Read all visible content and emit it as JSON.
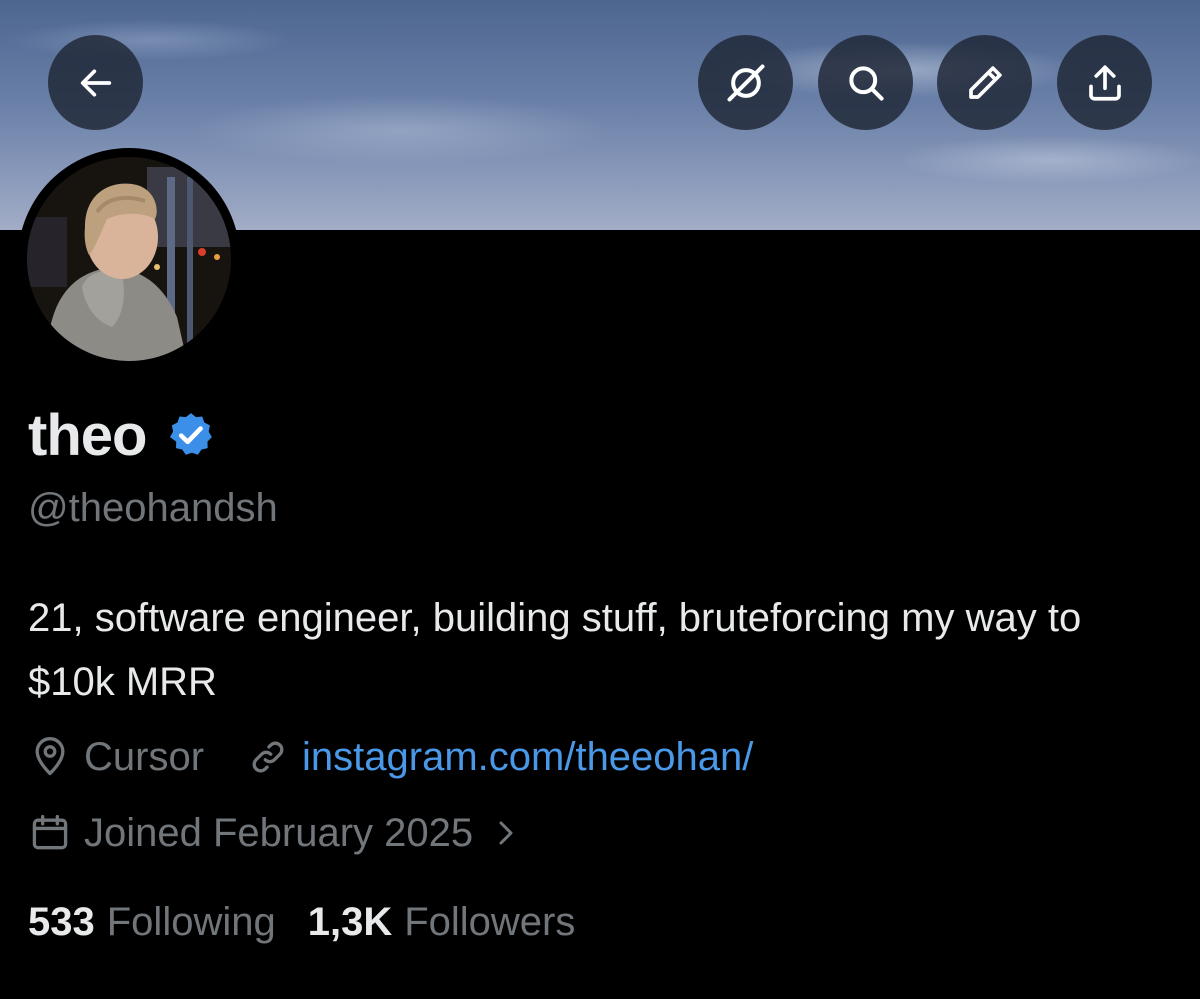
{
  "profile": {
    "display_name": "theo",
    "handle": "@theohandsh",
    "bio": "21, software engineer, building stuff, bruteforcing my way to $10k MRR",
    "location": "Cursor",
    "website": "instagram.com/theeohan/",
    "joined": "Joined February 2025",
    "verified": true
  },
  "stats": {
    "following_count": "533",
    "following_label": "Following",
    "followers_count": "1,3K",
    "followers_label": "Followers"
  },
  "header_buttons": [
    {
      "icon": "back-arrow-icon"
    },
    {
      "icon": "grok-icon"
    },
    {
      "icon": "search-icon"
    },
    {
      "icon": "edit-pencil-icon"
    },
    {
      "icon": "share-icon"
    }
  ],
  "colors": {
    "background": "#000000",
    "primary_text": "#e7e9ea",
    "secondary_text": "#71767b",
    "link": "#4a99e9",
    "verified_badge": "#3b8fe8"
  }
}
